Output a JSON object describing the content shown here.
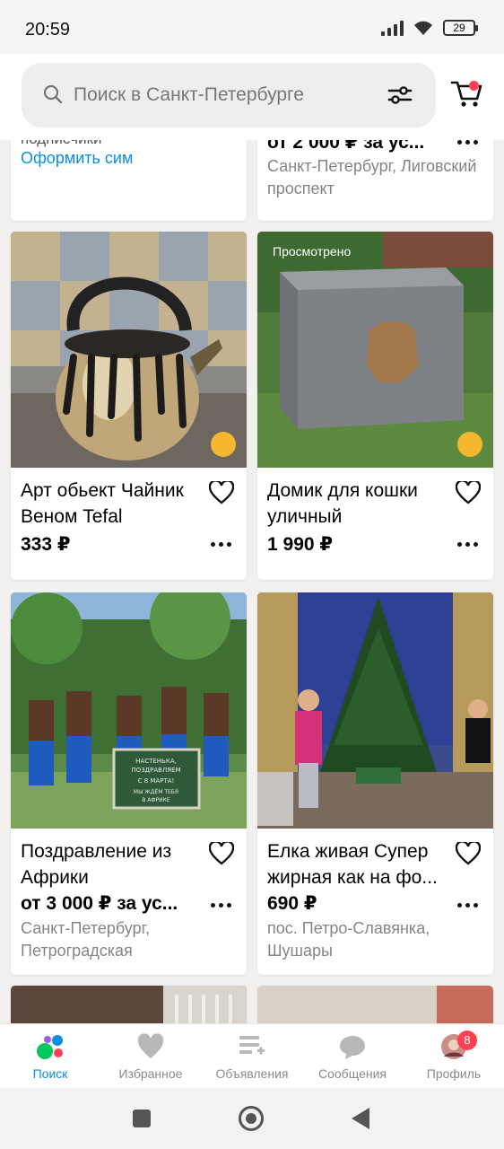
{
  "status_bar": {
    "time": "20:59",
    "battery": "29"
  },
  "search": {
    "placeholder": "Поиск в Санкт-Петербурге"
  },
  "listings": [
    {
      "title": "подписчики",
      "link": "Оформить сим"
    },
    {
      "price": "от 2 000 ₽ за ус...",
      "location": "Санкт-Петербург, Лиговский проспект"
    },
    {
      "title": "Арт обьект Чайник Веном Tefal",
      "price": "333 ₽"
    },
    {
      "title": "Домик для кошки уличный",
      "price": "1 990 ₽",
      "viewed": "Просмотрено"
    },
    {
      "title": "Поздравление из Африки",
      "price": "от 3 000 ₽ за ус...",
      "location": "Санкт-Петербург, Петроградская"
    },
    {
      "title": "Елка живая Супер жирная как на фо...",
      "price": "690 ₽",
      "location": "пос. Петро-Славянка, Шушары"
    }
  ],
  "photo_text": {
    "chalkboard": "НАСТЕНЬКА, ПОЗДРАВЛЯЕМ С 8 МАРТА! МЫ ЖДЁМ ТЕБЯ В АФРИКЕ"
  },
  "bottom_nav": [
    {
      "label": "Поиск",
      "icon": "search-dots-icon",
      "active": true
    },
    {
      "label": "Избранное",
      "icon": "heart-icon"
    },
    {
      "label": "Объявления",
      "icon": "add-listing-icon"
    },
    {
      "label": "Сообщения",
      "icon": "chat-icon"
    },
    {
      "label": "Профиль",
      "icon": "avatar-icon",
      "badge": "8"
    }
  ],
  "colors": {
    "accent": "#0a8ee2",
    "badge": "#ff4053",
    "delivery": "#f5b630"
  }
}
